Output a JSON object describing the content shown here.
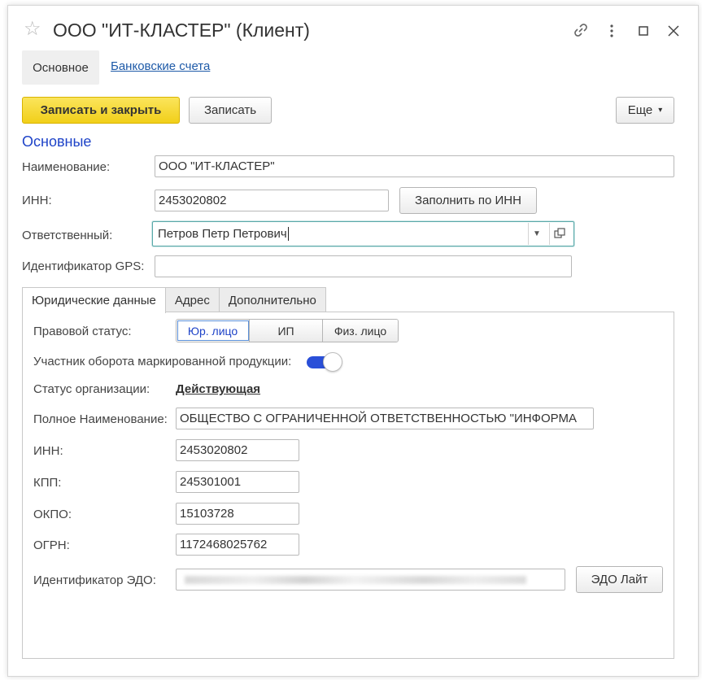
{
  "window": {
    "title": "ООО \"ИТ-КЛАСТЕР\" (Клиент)",
    "icons": [
      "star-icon",
      "link-icon",
      "more-vertical-icon",
      "maximize-icon",
      "close-icon"
    ]
  },
  "nav_tabs": {
    "main": "Основное",
    "bank": "Банковские счета"
  },
  "toolbar": {
    "save_close": "Записать и закрыть",
    "save": "Записать",
    "more": "Еще",
    "more_caret": "▾"
  },
  "section": {
    "title": "Основные"
  },
  "fields": {
    "name_label": "Наименование:",
    "name_value": "ООО \"ИТ-КЛАСТЕР\"",
    "inn_label": "ИНН:",
    "inn_value": "2453020802",
    "fill_by_inn": "Заполнить по ИНН",
    "responsible_label": "Ответственный:",
    "responsible_value": "Петров Петр Петрович",
    "gps_label": "Идентификатор GPS:",
    "gps_value": ""
  },
  "detail_tabs": [
    "Юридические данные",
    "Адрес",
    "Дополнительно"
  ],
  "legal": {
    "status_label": "Правовой статус:",
    "status_options": [
      "Юр. лицо",
      "ИП",
      "Физ. лицо"
    ],
    "status_selected": "Юр. лицо",
    "marking_label": "Участник оборота маркированной продукции:",
    "marking_on": true,
    "org_status_label": "Статус организации:",
    "org_status_value": "Действующая",
    "full_name_label": "Полное Наименование:",
    "full_name_value": "ОБЩЕСТВО С ОГРАНИЧЕННОЙ ОТВЕТСТВЕННОСТЬЮ \"ИНФОРМА",
    "inn_label": "ИНН:",
    "inn_value": "2453020802",
    "kpp_label": "КПП:",
    "kpp_value": "245301001",
    "okpo_label": "ОКПО:",
    "okpo_value": "15103728",
    "ogrn_label": "ОГРН:",
    "ogrn_value": "1172468025762",
    "edo_label": "Идентификатор ЭДО:",
    "edo_button": "ЭДО Лайт"
  },
  "colors": {
    "primary_button": "#f1cf19",
    "section_title": "#1e43c8",
    "link": "#1e5aa8",
    "toggle_on": "#2a4fd8",
    "focus_border": "#5aa9a9"
  }
}
